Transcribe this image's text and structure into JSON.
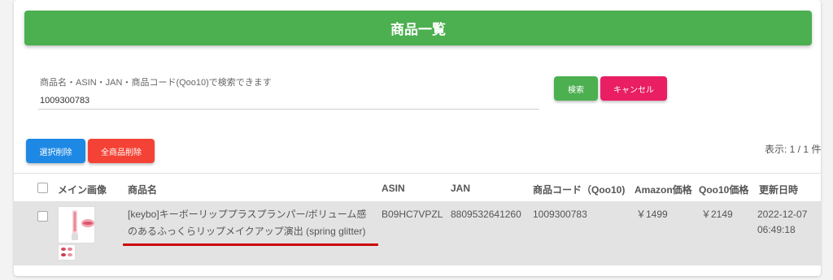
{
  "header": {
    "title": "商品一覧"
  },
  "search": {
    "label": "商品名・ASIN・JAN・商品コード(Qoo10)で検索できます",
    "value": "1009300783",
    "search_button": "検索",
    "cancel_button": "キャンセル"
  },
  "actions": {
    "delete_selected": "選択削除",
    "delete_all": "全商品削除"
  },
  "pager": {
    "text": "表示: 1 / 1 件"
  },
  "table": {
    "columns": {
      "image": "メイン画像",
      "name": "商品名",
      "asin": "ASIN",
      "jan": "JAN",
      "code": "商品コード（Qoo10)",
      "amazon_price": "Amazon価格",
      "qoo10_price": "Qoo10価格",
      "updated": "更新日時"
    },
    "rows": [
      {
        "name_line1": "[keybo]キーボーリッププラスプランパー/ボリューム感",
        "name_line2": "のあるふっくらリップメイクアップ演出 (spring glitter)",
        "asin": "B09HC7VPZL",
        "jan": "8809532641260",
        "code": "1009300783",
        "amazon_price": "￥1499",
        "qoo10_price": "￥2149",
        "updated_date": "2022-12-07",
        "updated_time": "06:49:18"
      }
    ]
  },
  "colors": {
    "header_green": "#4caf50",
    "cancel_pink": "#e91e63",
    "delete_blue": "#1e88e5",
    "delete_red": "#f44336",
    "highlight_underline": "#cc0000"
  },
  "icons": {
    "product_thumbnail": "product-image",
    "lip_thumbnail": "lip-image",
    "swatch_thumbnail": "swatch-image"
  }
}
